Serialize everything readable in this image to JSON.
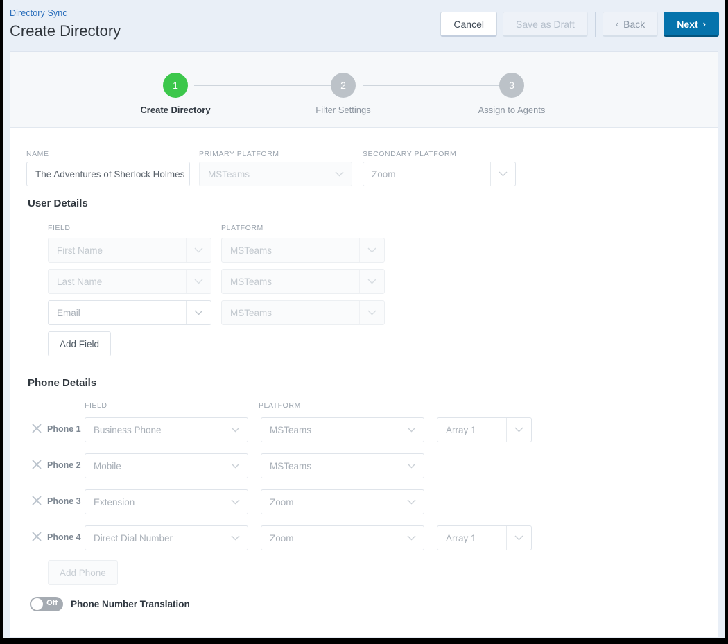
{
  "header": {
    "breadcrumb": "Directory Sync",
    "title": "Create Directory",
    "buttons": {
      "cancel": "Cancel",
      "save_as_draft": "Save as Draft",
      "back": "Back",
      "next": "Next",
      "back_chevron": "‹",
      "next_chevron": "›"
    }
  },
  "stepper": {
    "steps": [
      {
        "number": "1",
        "label": "Create Directory",
        "state": "active",
        "color": "#3cc74b"
      },
      {
        "number": "2",
        "label": "Filter Settings",
        "state": "inactive",
        "color": "#bcc2c8"
      },
      {
        "number": "3",
        "label": "Assign to Agents",
        "state": "inactive",
        "color": "#bcc2c8"
      }
    ]
  },
  "form": {
    "name": {
      "label": "NAME",
      "value": "The Adventures of Sherlock Holmes"
    },
    "primary_platform": {
      "label": "PRIMARY PLATFORM",
      "value": "MSTeams"
    },
    "secondary_platform": {
      "label": "SECONDARY PLATFORM",
      "value": "Zoom"
    }
  },
  "user_details": {
    "title": "User Details",
    "columns": {
      "field": "FIELD",
      "platform": "PLATFORM"
    },
    "rows": [
      {
        "field": "First Name",
        "platform": "MSTeams",
        "field_state": "muted",
        "platform_state": "muted"
      },
      {
        "field": "Last Name",
        "platform": "MSTeams",
        "field_state": "muted",
        "platform_state": "muted"
      },
      {
        "field": "Email",
        "platform": "MSTeams",
        "field_state": "active",
        "platform_state": "muted"
      }
    ],
    "add_field_button": "Add Field"
  },
  "phone_details": {
    "title": "Phone Details",
    "columns": {
      "field": "FIELD",
      "platform": "PLATFORM"
    },
    "rows": [
      {
        "label": "Phone 1",
        "field": "Business Phone",
        "platform": "MSTeams",
        "array": "Array 1",
        "has_array": true
      },
      {
        "label": "Phone 2",
        "field": "Mobile",
        "platform": "MSTeams",
        "array": "",
        "has_array": false
      },
      {
        "label": "Phone 3",
        "field": "Extension",
        "platform": "Zoom",
        "array": "",
        "has_array": false
      },
      {
        "label": "Phone 4",
        "field": "Direct Dial Number",
        "platform": "Zoom",
        "array": "Array 1",
        "has_array": true
      }
    ],
    "add_phone_button": "Add Phone",
    "remove_icon": "close-icon"
  },
  "phone_translation": {
    "toggle_state": "Off",
    "label": "Phone Number Translation"
  },
  "colors": {
    "accent_blue": "#0573ac",
    "breadcrumb_blue": "#2a6ebb",
    "step_active_green": "#3cc74b",
    "step_inactive_grey": "#bcc2c8",
    "header_bg": "#e9eff7",
    "stepper_bg": "#f6f8fa",
    "border": "#dfe4ea"
  }
}
